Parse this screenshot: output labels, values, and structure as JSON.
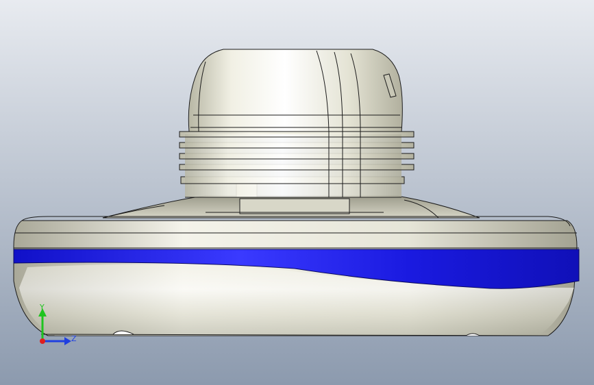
{
  "viewport": {
    "background_top": "#e6e9ee",
    "background_bottom": "#8e9cb0"
  },
  "model": {
    "body_color": "#ecebdf",
    "body_shadow": "#b9b8a8",
    "stripe_color": "#1414d8",
    "outline_color": "#1a1a1a"
  },
  "triad": {
    "y_label": "Y",
    "z_label": "Z",
    "y_color": "#1fc41f",
    "z_color": "#1f3fe0",
    "x_color": "#e01f1f"
  }
}
